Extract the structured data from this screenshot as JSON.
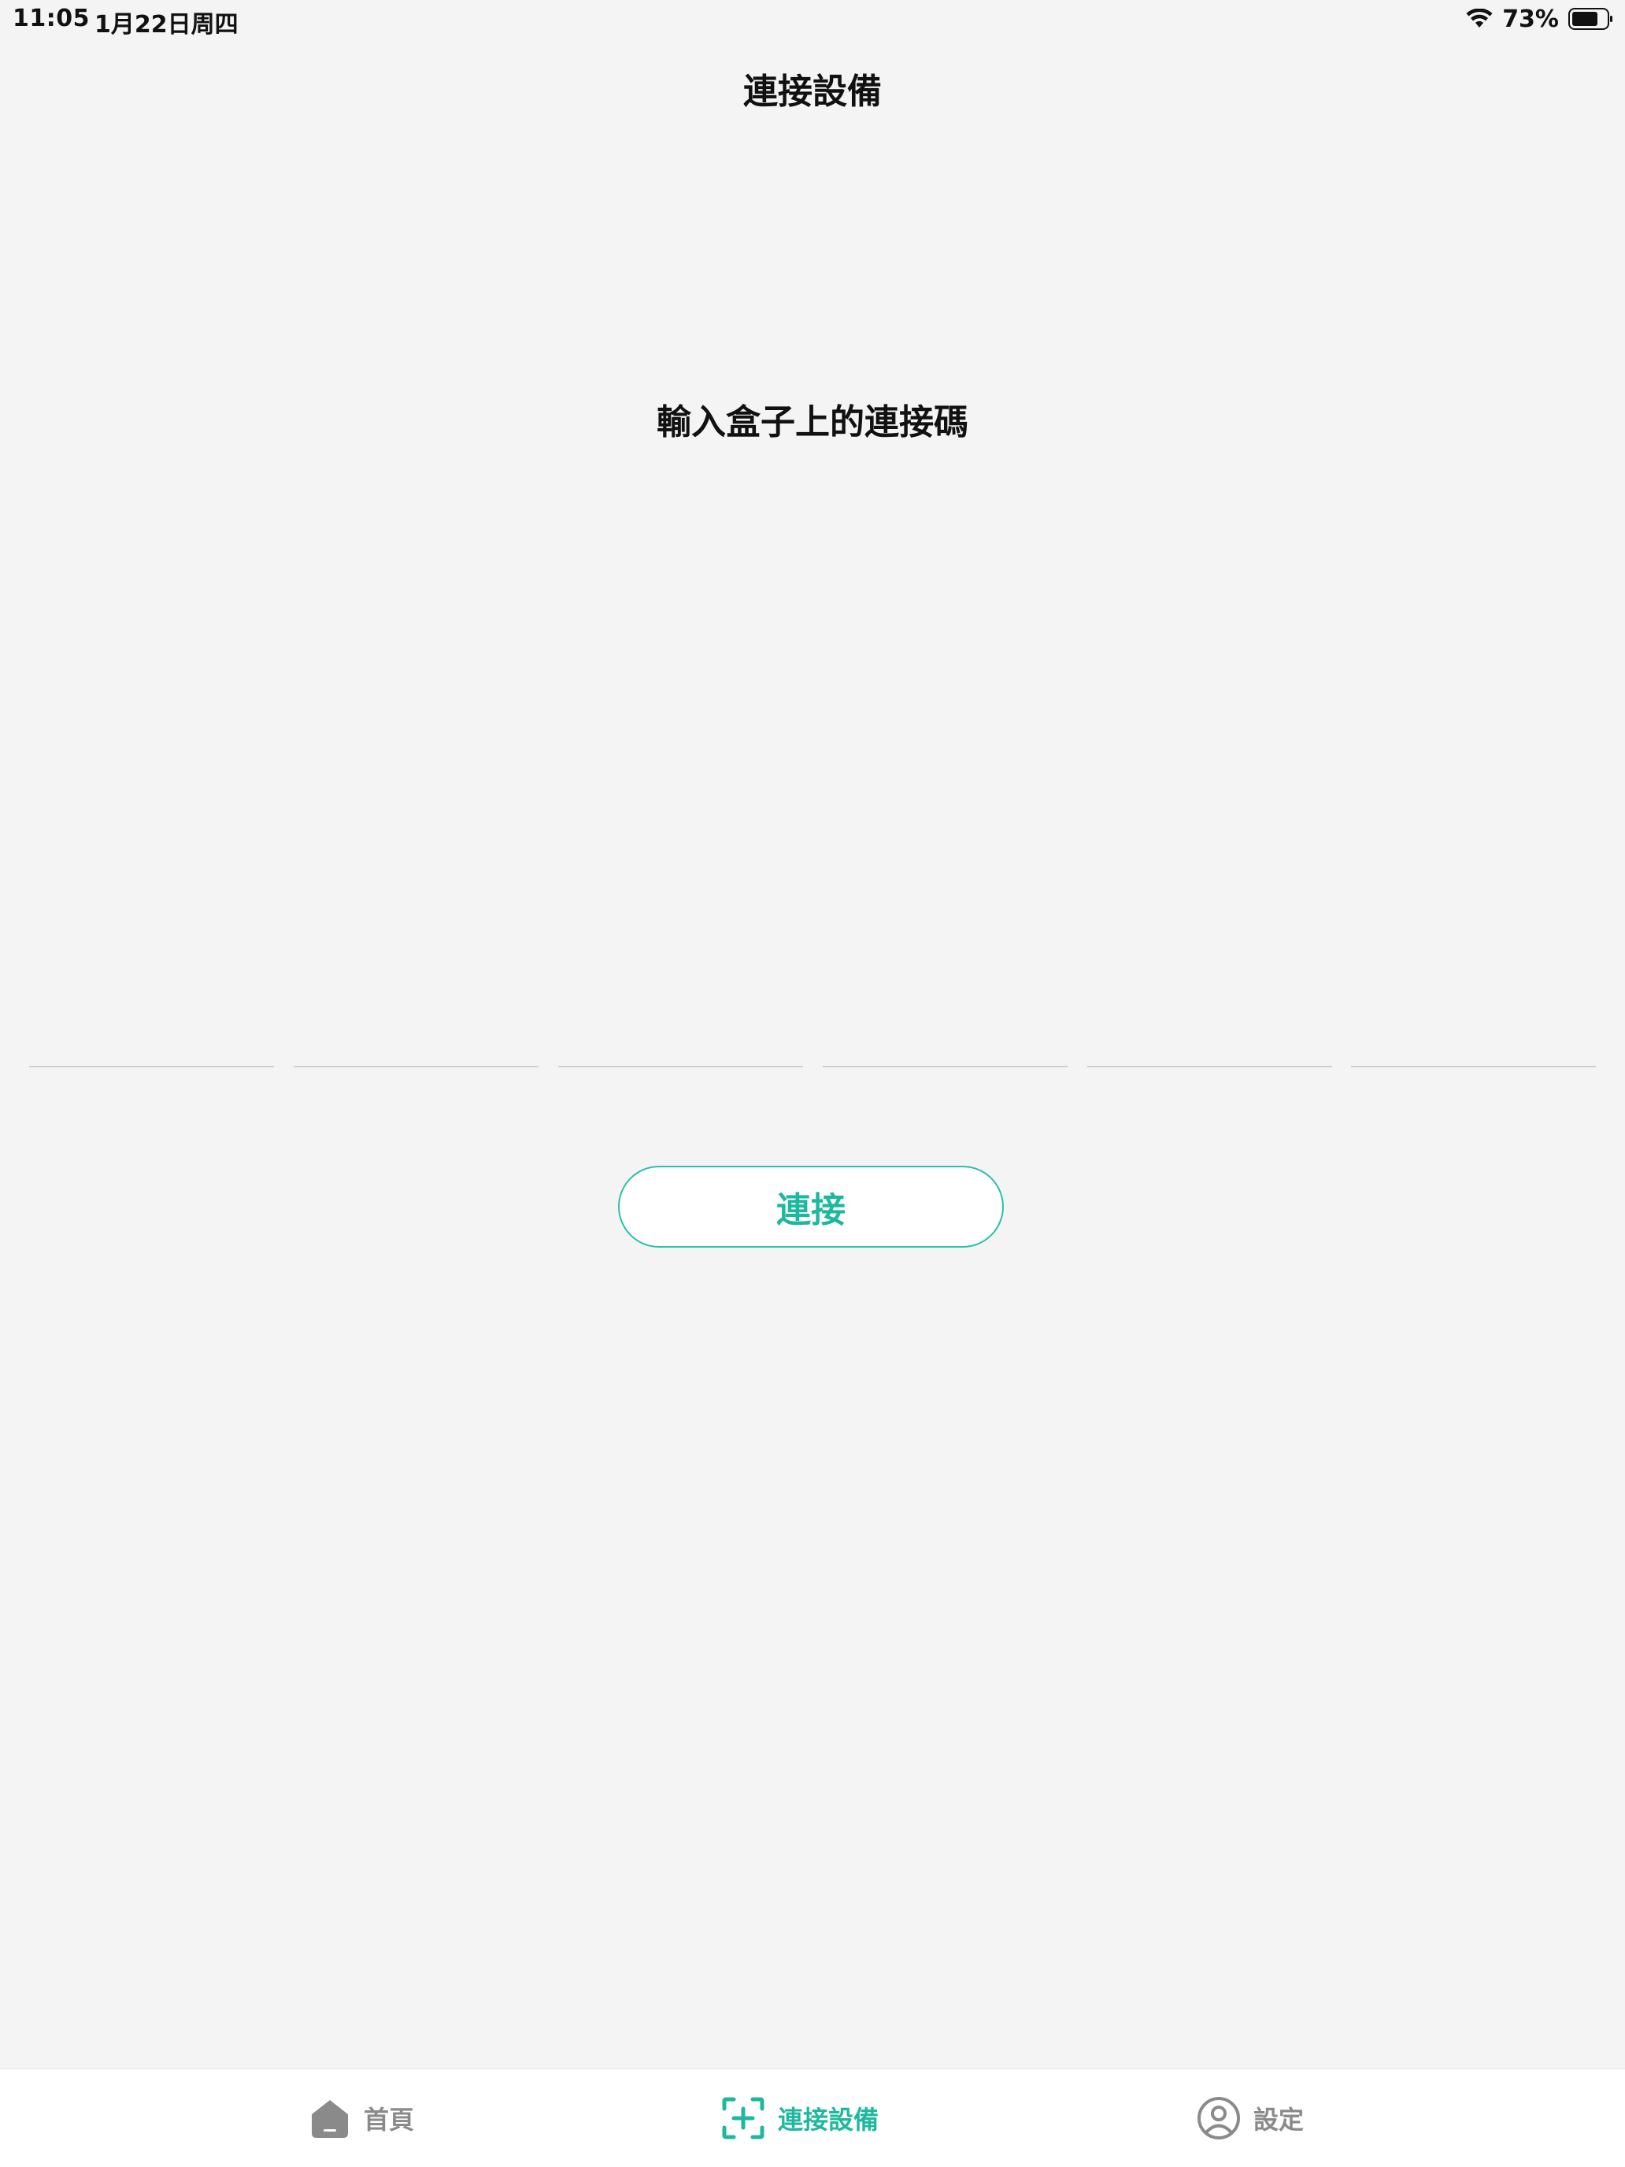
{
  "status_bar": {
    "time": "11:05",
    "date": "1月22日周四",
    "battery": "73%"
  },
  "nav": {
    "title": "連接設備"
  },
  "main": {
    "prompt": "輸入盒子上的連接碼",
    "code_slots": [
      "",
      "",
      "",
      "",
      "",
      ""
    ],
    "connect_label": "連接"
  },
  "tab_bar": {
    "items": [
      {
        "label": "首頁",
        "icon": "home-icon",
        "active": false
      },
      {
        "label": "連接設備",
        "icon": "scan-add-icon",
        "active": true
      },
      {
        "label": "設定",
        "icon": "user-icon",
        "active": false
      }
    ]
  },
  "colors": {
    "accent": "#1fb89f",
    "background": "#f4f4f4",
    "inactive": "#8a8a8a"
  }
}
